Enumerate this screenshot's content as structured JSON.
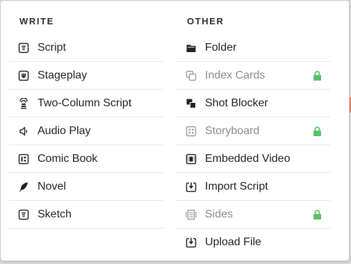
{
  "write": {
    "heading": "WRITE",
    "items": [
      {
        "label": "Script",
        "icon": "script-icon"
      },
      {
        "label": "Stageplay",
        "icon": "stageplay-mask-icon"
      },
      {
        "label": "Two-Column Script",
        "icon": "two-column-script-icon"
      },
      {
        "label": "Audio Play",
        "icon": "speaker-icon"
      },
      {
        "label": "Comic Book",
        "icon": "comic-book-icon"
      },
      {
        "label": "Novel",
        "icon": "quill-icon"
      },
      {
        "label": "Sketch",
        "icon": "sketch-icon"
      }
    ]
  },
  "other": {
    "heading": "OTHER",
    "items": [
      {
        "label": "Folder",
        "icon": "folder-icon",
        "locked": false
      },
      {
        "label": "Index Cards",
        "icon": "index-cards-icon",
        "locked": true
      },
      {
        "label": "Shot Blocker",
        "icon": "shot-blocker-icon",
        "locked": false
      },
      {
        "label": "Storyboard",
        "icon": "storyboard-icon",
        "locked": true
      },
      {
        "label": "Embedded Video",
        "icon": "film-icon",
        "locked": false
      },
      {
        "label": "Import Script",
        "icon": "import-icon",
        "locked": false
      },
      {
        "label": "Sides",
        "icon": "sides-icon",
        "locked": true
      },
      {
        "label": "Upload File",
        "icon": "upload-icon",
        "locked": false
      }
    ]
  },
  "colors": {
    "lock": "#5cc06a",
    "text": "#1e1e1e",
    "disabled_text": "#8a8a8a",
    "divider": "#e6e6e6"
  }
}
